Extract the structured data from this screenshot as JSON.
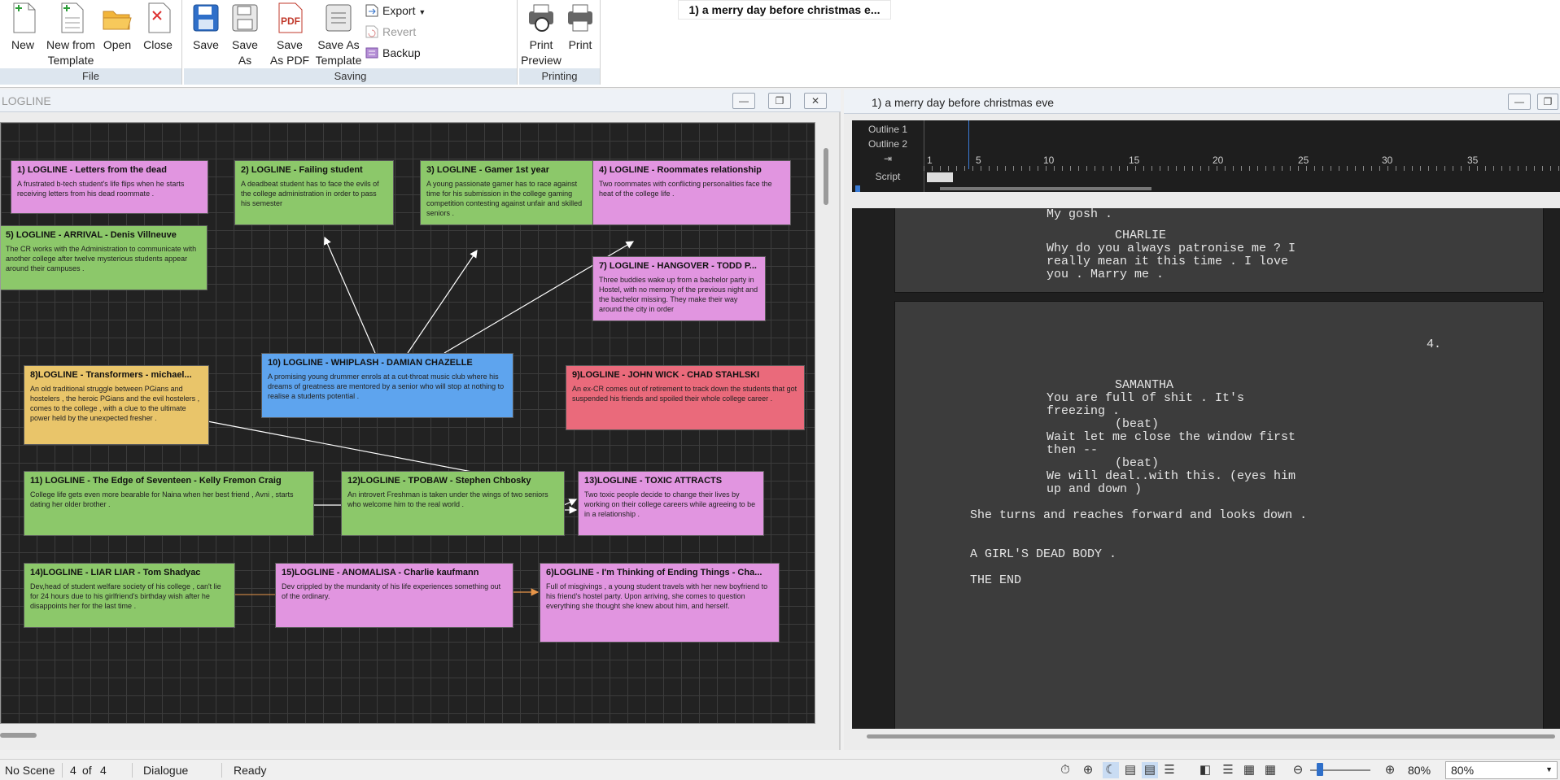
{
  "ribbon": {
    "file": {
      "label": "File",
      "new": "New",
      "new_from_template_1": "New from",
      "new_from_template_2": "Template",
      "open": "Open",
      "close": "Close"
    },
    "saving": {
      "label": "Saving",
      "save": "Save",
      "save_as_1": "Save",
      "save_as_2": "As",
      "save_pdf_1": "Save",
      "save_pdf_2": "As PDF",
      "save_template_1": "Save As",
      "save_template_2": "Template",
      "export": "Export",
      "revert": "Revert",
      "backup": "Backup"
    },
    "printing": {
      "label": "Printing",
      "print_preview_1": "Print",
      "print_preview_2": "Preview",
      "print": "Print"
    },
    "doc_tab": "1) a merry day before christmas e..."
  },
  "logline": {
    "title": "LOGLINE",
    "cards": [
      {
        "title": "1) LOGLINE - Letters from the dead",
        "desc": "A frustrated b-tech student's life flips when he starts receiving letters from his dead roommate ."
      },
      {
        "title": "2) LOGLINE - Failing student",
        "desc": "A deadbeat student has to face the evils of the college administration in order to pass his semester"
      },
      {
        "title": "3) LOGLINE - Gamer 1st year",
        "desc": "A young passionate gamer has to race against time for his submission in the college gaming competition contesting against unfair and skilled seniors ."
      },
      {
        "title": "4) LOGLINE - Roommates relationship",
        "desc": "Two roommates with conflicting personalities face the heat of the college life ."
      },
      {
        "title": "5) LOGLINE - ARRIVAL - Denis Villneuve",
        "desc": "The CR works with the Administration to communicate with another college after twelve mysterious students appear around their campuses ."
      },
      {
        "title": "7) LOGLINE - HANGOVER - TODD P...",
        "desc": "Three buddies wake up from a bachelor party in Hostel, with no memory of the previous night and the bachelor missing. They make their way around the city in order"
      },
      {
        "title": "10) LOGLINE - WHIPLASH - DAMIAN CHAZELLE",
        "desc": "A promising young drummer enrols at a cut-throat music club where his dreams of greatness are mentored by a senior who will stop at nothing to realise a students potential ."
      },
      {
        "title": "8)LOGLINE - Transformers - michael...",
        "desc": "An old traditional struggle between PGians and hostelers , the heroic PGians and the evil hostelers , comes to the college , with a clue to the ultimate power held by the unexpected fresher ."
      },
      {
        "title": "9)LOGLINE - JOHN WICK - CHAD STAHLSKI",
        "desc": "An ex-CR comes out of retirement to track down the students that got suspended his friends and spoiled their whole college career ."
      },
      {
        "title": "11) LOGLINE - The Edge of Seventeen - Kelly Fremon Craig",
        "desc": "College life gets even more bearable for Naina when her best friend , Avni , starts dating her older brother ."
      },
      {
        "title": "12)LOGLINE - TPOBAW - Stephen Chbosky",
        "desc": "An introvert Freshman is taken under the wings of two seniors who welcome him to the real world ."
      },
      {
        "title": "13)LOGLINE - TOXIC ATTRACTS",
        "desc": "Two toxic people decide to change their lives by working on their college careers while agreeing to be in a relationship ."
      },
      {
        "title": "14)LOGLINE - LIAR LIAR - Tom Shadyac",
        "desc": "Dev,head of student welfare society of his college , can't lie for 24 hours due to his girlfriend's birthday wish after he disappoints her for the last time ."
      },
      {
        "title": "15)LOGLINE - ANOMALISA - Charlie kaufmann",
        "desc": "Dev crippled by the mundanity of his life experiences something out of the ordinary."
      },
      {
        "title": "6)LOGLINE - I'm Thinking of Ending Things - Cha...",
        "desc": "Full of misgivings , a young student travels with her new boyfriend to his friend's hostel party. Upon arriving, she comes to question everything she thought she knew about him, and herself."
      }
    ]
  },
  "script": {
    "title": "1) a merry day before christmas eve",
    "outline_1": "Outline 1",
    "outline_2": "Outline 2",
    "script_label": "Script",
    "ruler": [
      "1",
      "5",
      "10",
      "15",
      "20",
      "25",
      "30",
      "35"
    ],
    "page1_lines": [
      "My gosh .",
      "CHARLIE",
      "Why do you always patronise me ? I",
      "really mean it this time . I love",
      "you . Marry me ."
    ],
    "page_number": "4.",
    "page2_lines": [
      "SAMANTHA",
      "You are full of shit . It's",
      "freezing .",
      "(beat)",
      "Wait let me close the window first",
      "then --",
      "(beat)",
      "We will deal..with this. (eyes him",
      "up and down )",
      "She turns and reaches forward and looks down .",
      "A GIRL'S DEAD BODY .",
      "THE END"
    ]
  },
  "status": {
    "scene": "No Scene",
    "page_current": "4",
    "page_of": "of",
    "page_total": "4",
    "element": "Dialogue",
    "state": "Ready",
    "zoom_label": "80%",
    "zoom_value": "80%"
  }
}
